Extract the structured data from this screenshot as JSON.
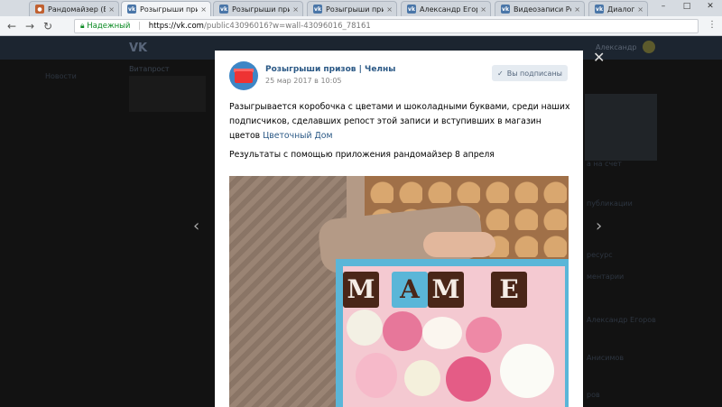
{
  "browser": {
    "tabs": [
      {
        "title": "Рандомайзер (Вы",
        "fav_color": "#c06030",
        "fav_glyph": "●",
        "active": false
      },
      {
        "title": "Розыгрыши призо",
        "fav_color": "#4a76a8",
        "fav_glyph": "vk",
        "active": true
      },
      {
        "title": "Розыгрыши призо",
        "fav_color": "#4a76a8",
        "fav_glyph": "vk",
        "active": false
      },
      {
        "title": "Розыгрыши призо",
        "fav_color": "#4a76a8",
        "fav_glyph": "vk",
        "active": false
      },
      {
        "title": "Александр Егоров",
        "fav_color": "#4a76a8",
        "fav_glyph": "vk",
        "active": false
      },
      {
        "title": "Видеозаписи Розы",
        "fav_color": "#4a76a8",
        "fav_glyph": "vk",
        "active": false
      },
      {
        "title": "Диалоги",
        "fav_color": "#4a76a8",
        "fav_glyph": "vk",
        "active": false
      }
    ],
    "address": {
      "secure_label": "Надежный",
      "host": "https://vk.com",
      "path": "/public43096016?w=wall-43096016_78161"
    }
  },
  "vk": {
    "user_name": "Александр",
    "left_menu": [
      "Новости"
    ],
    "side_texts": [
      "Витапрост",
      "а на счет",
      "публикации",
      "ресурс",
      "ментарии",
      "Александр Егоров",
      "Анисимов",
      "ров"
    ]
  },
  "post": {
    "group_name": "Розыгрыши призов | Челны",
    "date": "25 мар 2017 в 10:05",
    "subscribed_label": "Вы подписаны",
    "text_part1": "Разыгрывается коробочка с цветами и шоколадными буквами, среди наших подписчиков, сделавших репост этой записи и вступивших в магазин цветов ",
    "text_link": "Цветочный Дом",
    "text_line2": "Результаты с помощью приложения рандомайзер 8 апреля",
    "photo_letters": [
      "М",
      "А",
      "М",
      "Е"
    ]
  },
  "colors": {
    "vk_blue": "#2a5885",
    "secure_green": "#0a8a22"
  }
}
